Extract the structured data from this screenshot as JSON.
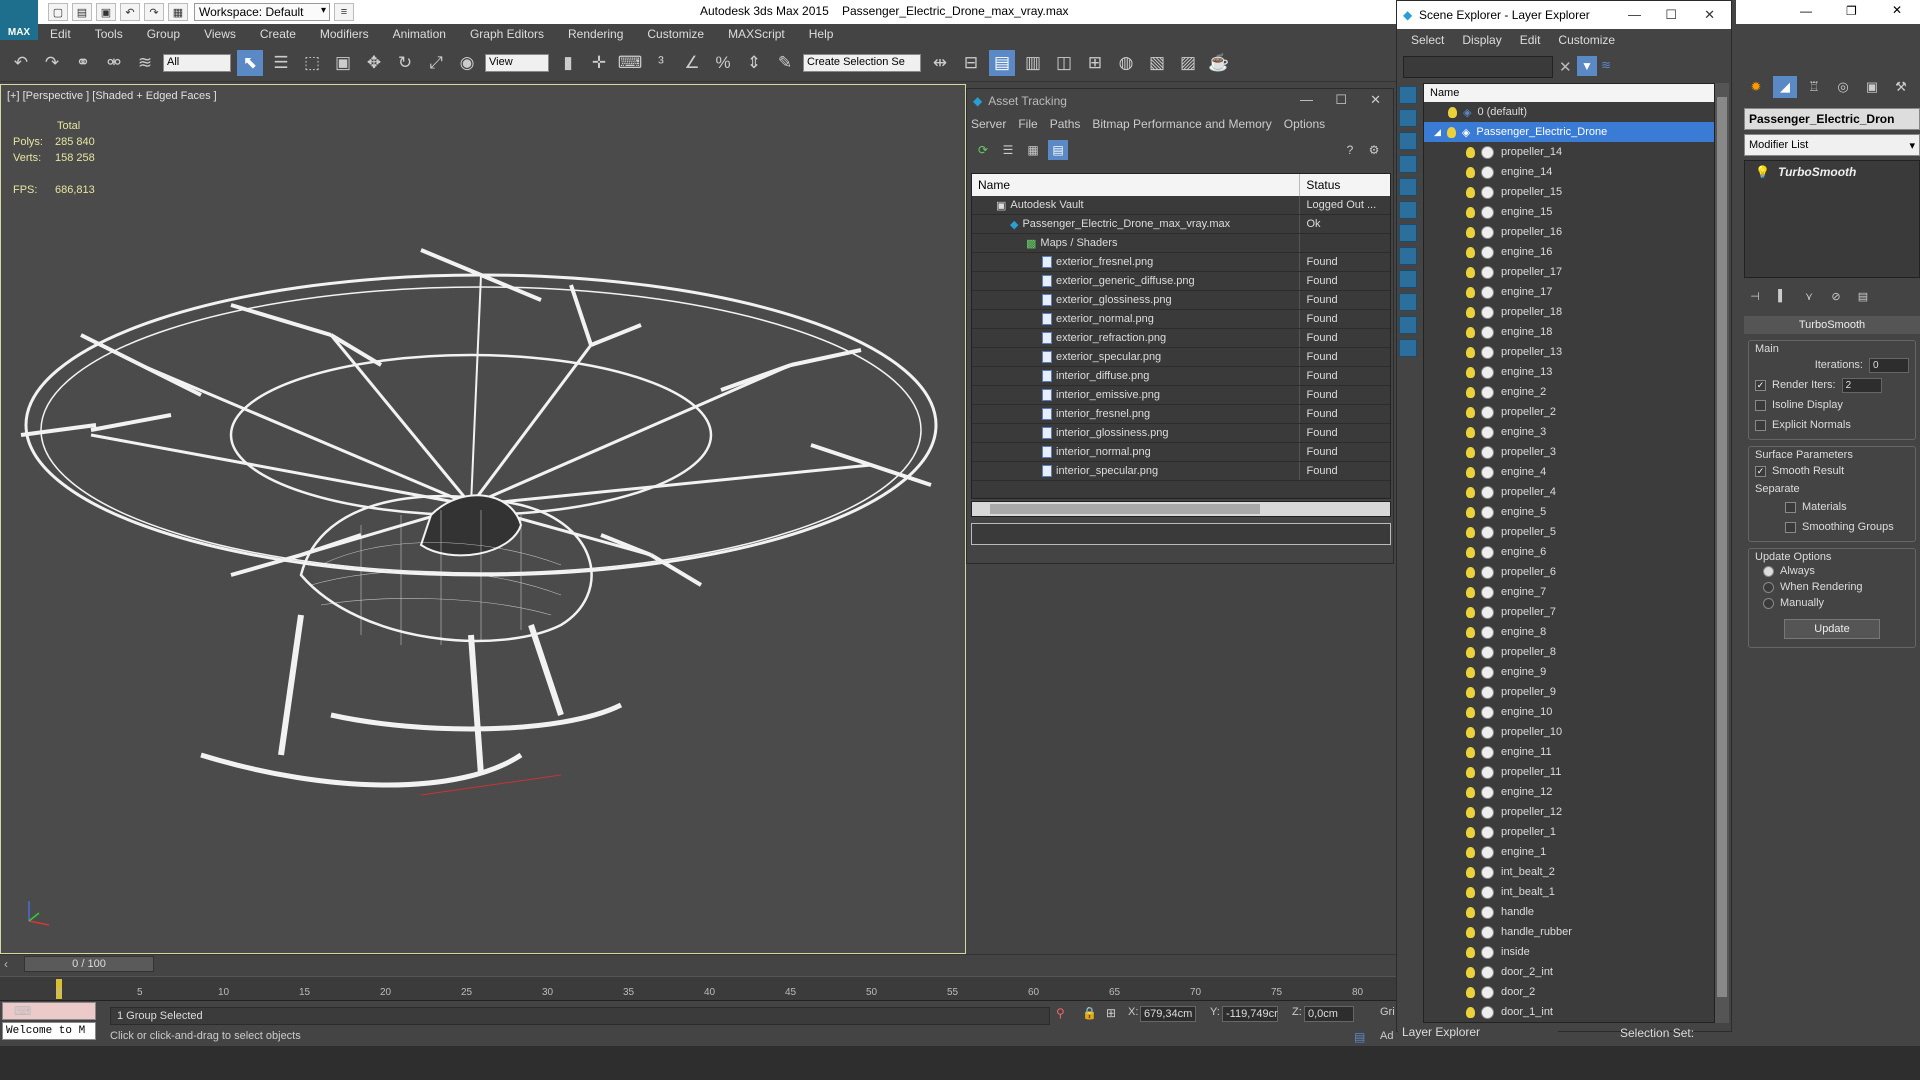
{
  "app": {
    "logo": "MAX",
    "workspace": "Workspace: Default",
    "title": "Autodesk 3ds Max  2015",
    "file": "Passenger_Electric_Drone_max_vray.max"
  },
  "menu": [
    "Edit",
    "Tools",
    "Group",
    "Views",
    "Create",
    "Modifiers",
    "Animation",
    "Graph Editors",
    "Rendering",
    "Customize",
    "MAXScript",
    "Help"
  ],
  "toolbar": {
    "filter": "All",
    "refcoord": "View",
    "selset": "Create Selection Se"
  },
  "viewport": {
    "label": "[+] [Perspective ] [Shaded + Edged Faces ]",
    "total": "Total",
    "polys_label": "Polys:",
    "polys": "285 840",
    "verts_label": "Verts:",
    "verts": "158 258",
    "fps_label": "FPS:",
    "fps": "686,813"
  },
  "asset": {
    "title": "Asset Tracking",
    "menu": [
      "Server",
      "File",
      "Paths",
      "Bitmap Performance and Memory",
      "Options"
    ],
    "col_name": "Name",
    "col_status": "Status",
    "rows": [
      {
        "name": "Autodesk Vault",
        "status": "Logged Out ..."
      },
      {
        "name": "Passenger_Electric_Drone_max_vray.max",
        "status": "Ok"
      },
      {
        "name": "Maps / Shaders",
        "status": ""
      },
      {
        "name": "exterior_fresnel.png",
        "status": "Found"
      },
      {
        "name": "exterior_generic_diffuse.png",
        "status": "Found"
      },
      {
        "name": "exterior_glossiness.png",
        "status": "Found"
      },
      {
        "name": "exterior_normal.png",
        "status": "Found"
      },
      {
        "name": "exterior_refraction.png",
        "status": "Found"
      },
      {
        "name": "exterior_specular.png",
        "status": "Found"
      },
      {
        "name": "interior_diffuse.png",
        "status": "Found"
      },
      {
        "name": "interior_emissive.png",
        "status": "Found"
      },
      {
        "name": "interior_fresnel.png",
        "status": "Found"
      },
      {
        "name": "interior_glossiness.png",
        "status": "Found"
      },
      {
        "name": "interior_normal.png",
        "status": "Found"
      },
      {
        "name": "interior_specular.png",
        "status": "Found"
      }
    ]
  },
  "scene": {
    "title": "Scene Explorer - Layer Explorer",
    "menu": [
      "Select",
      "Display",
      "Edit",
      "Customize"
    ],
    "col": "Name",
    "layers": [
      "0 (default)",
      "Passenger_Electric_Drone"
    ],
    "items": [
      "propeller_14",
      "engine_14",
      "propeller_15",
      "engine_15",
      "propeller_16",
      "engine_16",
      "propeller_17",
      "engine_17",
      "propeller_18",
      "engine_18",
      "propeller_13",
      "engine_13",
      "engine_2",
      "propeller_2",
      "engine_3",
      "propeller_3",
      "engine_4",
      "propeller_4",
      "engine_5",
      "propeller_5",
      "engine_6",
      "propeller_6",
      "engine_7",
      "propeller_7",
      "engine_8",
      "propeller_8",
      "engine_9",
      "propeller_9",
      "engine_10",
      "propeller_10",
      "engine_11",
      "propeller_11",
      "engine_12",
      "propeller_12",
      "propeller_1",
      "engine_1",
      "int_bealt_2",
      "int_bealt_1",
      "handle",
      "handle_rubber",
      "inside",
      "door_2_int",
      "door_2",
      "door_1_int"
    ],
    "footer_layer": "Layer Explorer",
    "footer_selset": "Selection Set:"
  },
  "cmd": {
    "object": "Passenger_Electric_Dron",
    "modlist": "Modifier List",
    "modifier": "TurboSmooth",
    "rollout": "TurboSmooth",
    "main": "Main",
    "iterations": "Iterations:",
    "iter_val": "0",
    "render_iters": "Render Iters:",
    "render_val": "2",
    "isoline": "Isoline Display",
    "explicit": "Explicit Normals",
    "surface": "Surface Parameters",
    "smooth": "Smooth Result",
    "separate": "Separate",
    "materials": "Materials",
    "smgroups": "Smoothing Groups",
    "update_opts": "Update Options",
    "always": "Always",
    "when_render": "When Rendering",
    "manually": "Manually",
    "update": "Update"
  },
  "time": {
    "slider": "0 / 100",
    "ticks": [
      "0",
      "5",
      "10",
      "15",
      "20",
      "25",
      "30",
      "35",
      "40",
      "45",
      "50",
      "55",
      "60",
      "65",
      "70",
      "75",
      "80"
    ]
  },
  "status": {
    "selected": "1 Group Selected",
    "hint": "Click or click-and-drag to select objects",
    "maxscript": "Welcome to M",
    "x_label": "X:",
    "x": "679,34cm",
    "y_label": "Y:",
    "y": "-119,749cr",
    "z_label": "Z:",
    "z": "0,0cm",
    "grid": "Gri",
    "add": "Ad"
  }
}
